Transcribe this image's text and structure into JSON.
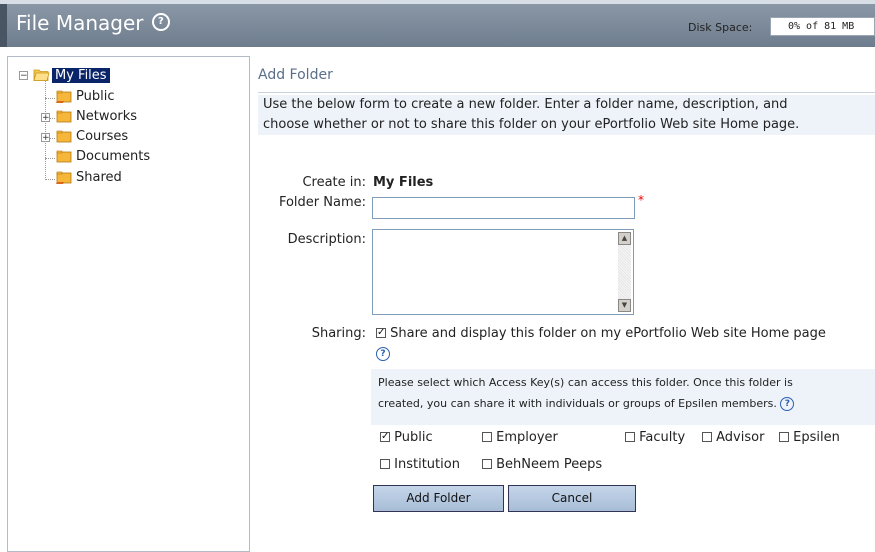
{
  "header": {
    "title": "File Manager",
    "help_icon": "question-circle-icon",
    "disk_label": "Disk Space:",
    "disk_value": "0% of 81 MB"
  },
  "tree": {
    "root": "My Files",
    "items": [
      "Public",
      "Networks",
      "Courses",
      "Documents",
      "Shared"
    ]
  },
  "panel": {
    "title": "Add Folder",
    "intro_line1": "Use the below form to create a new folder. Enter a folder name, description, and",
    "intro_line2": "choose whether or not to share this folder on your ePortfolio Web site Home page."
  },
  "form": {
    "create_in_label": "Create in:",
    "create_in_value": "My Files",
    "folder_name_label": "Folder Name:",
    "folder_name_value": "",
    "required_marker": "*",
    "description_label": "Description:",
    "description_value": "",
    "sharing_label": "Sharing:",
    "share_text": "Share and display this folder on my ePortfolio Web site Home page",
    "share_checked": true,
    "access_text_line1": "Please select which Access Key(s) can access this folder. Once this folder is",
    "access_text_line2": "created, you can share it with individuals or groups of Epsilen members.",
    "access_keys": [
      {
        "label": "Public",
        "checked": true
      },
      {
        "label": "Employer",
        "checked": false
      },
      {
        "label": "Faculty",
        "checked": false
      },
      {
        "label": "Advisor",
        "checked": false
      },
      {
        "label": "Epsilen",
        "checked": false
      },
      {
        "label": "Institution",
        "checked": false
      },
      {
        "label": "BehNeem Peeps",
        "checked": false
      }
    ],
    "add_button": "Add Folder",
    "cancel_button": "Cancel"
  },
  "colors": {
    "header_bg": "#7d8a9a",
    "selected_bg": "#0a246a",
    "panel_title": "#5a6f8a",
    "info_bg": "#eef3f9"
  }
}
